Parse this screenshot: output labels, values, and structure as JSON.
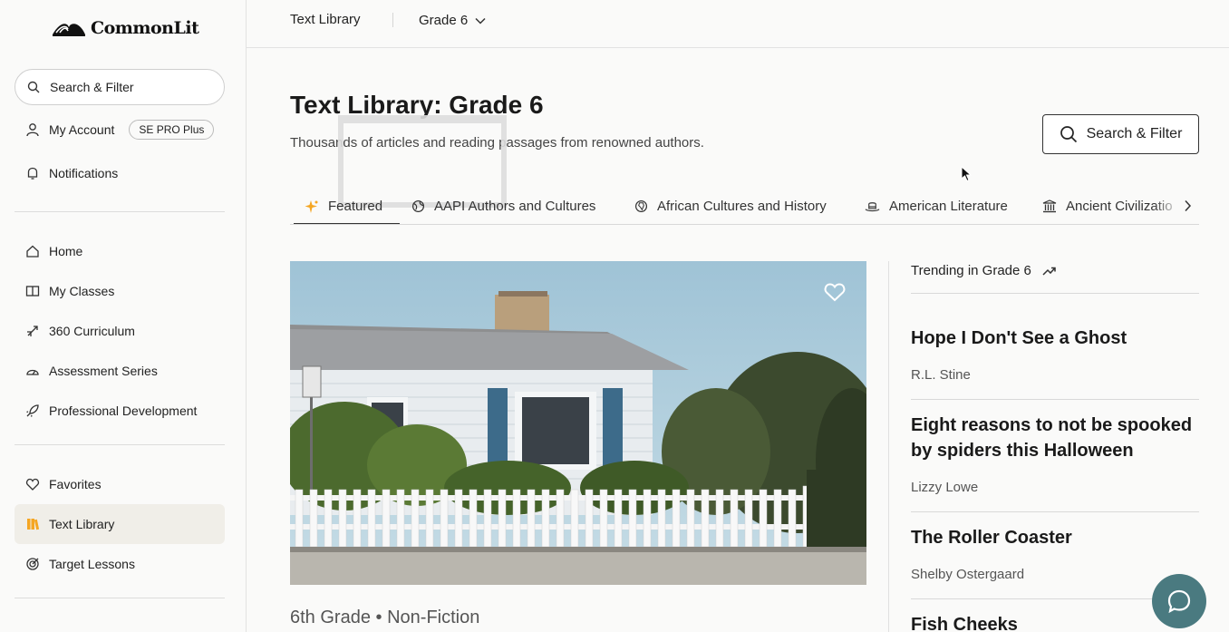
{
  "brand": {
    "name": "CommonLit"
  },
  "sidebar": {
    "search_label": "Search & Filter",
    "account_label": "My Account",
    "account_badge": "SE PRO Plus",
    "notifications_label": "Notifications",
    "nav": [
      {
        "label": "Home",
        "icon": "home-icon"
      },
      {
        "label": "My Classes",
        "icon": "classes-icon"
      },
      {
        "label": "360 Curriculum",
        "icon": "curriculum-icon"
      },
      {
        "label": "Assessment Series",
        "icon": "gauge-icon"
      },
      {
        "label": "Professional Development",
        "icon": "rocket-icon"
      }
    ],
    "nav2": [
      {
        "label": "Favorites",
        "icon": "heart-icon"
      },
      {
        "label": "Text Library",
        "icon": "books-icon",
        "active": true
      },
      {
        "label": "Target Lessons",
        "icon": "target-icon"
      }
    ]
  },
  "topbar": {
    "crumb": "Text Library",
    "grade": "Grade 6"
  },
  "main": {
    "title": "Text Library: Grade 6",
    "subtitle": "Thousands of articles and reading passages from renowned authors.",
    "search_button": "Search & Filter",
    "tabs": [
      {
        "label": "Featured",
        "icon": "sparkle-icon",
        "active": true
      },
      {
        "label": "AAPI Authors and Cultures",
        "icon": "globe-icon"
      },
      {
        "label": "African Cultures and History",
        "icon": "globe-africa-icon"
      },
      {
        "label": "American Literature",
        "icon": "hat-icon"
      },
      {
        "label": "Ancient Civilizatio",
        "icon": "temple-icon"
      }
    ],
    "featured": {
      "meta_grade": "6th Grade",
      "meta_sep": "•",
      "meta_genre": "Non-Fiction"
    }
  },
  "trending": {
    "heading": "Trending in Grade 6",
    "items": [
      {
        "title": "Hope I Don't See a Ghost",
        "author": "R.L. Stine"
      },
      {
        "title": "Eight reasons to not be spooked by spiders this Halloween",
        "author": "Lizzy Lowe"
      },
      {
        "title": "The Roller Coaster",
        "author": "Shelby Ostergaard"
      },
      {
        "title": "Fish Cheeks",
        "author": ""
      }
    ]
  },
  "colors": {
    "accent": "#f5a623",
    "help": "#4a7a80",
    "active_bg": "#f0eee8"
  }
}
